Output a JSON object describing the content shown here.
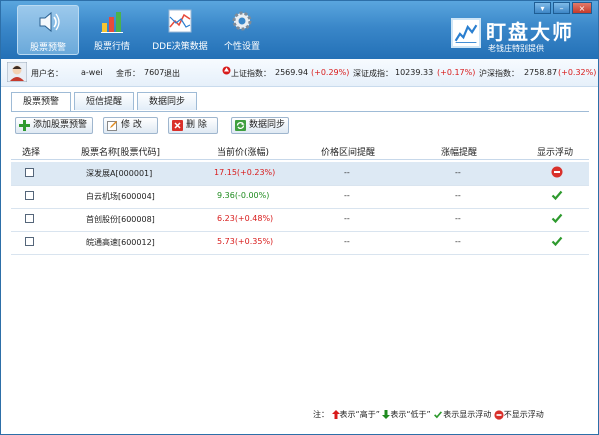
{
  "nav": {
    "items": [
      {
        "label": "股票预警",
        "active": true,
        "icon": "speaker-icon"
      },
      {
        "label": "股票行情",
        "active": false,
        "icon": "bar-chart-icon"
      },
      {
        "label": "DDE决策数据",
        "active": false,
        "icon": "line-chart-icon"
      },
      {
        "label": "个性设置",
        "active": false,
        "icon": "gear-icon"
      }
    ]
  },
  "window_controls": {
    "menu": "▾",
    "minimize": "–",
    "close": "×"
  },
  "brand": {
    "title": "盯盘大师",
    "subtitle": "老钱庄特别提供"
  },
  "user": {
    "username_label": "用户名：",
    "username": "a-wei",
    "coins_label": "金币：",
    "coins": "7607",
    "logout": "退出"
  },
  "indices": [
    {
      "label": "上证指数：",
      "value": "2569.94",
      "change": "(+0.29%)"
    },
    {
      "label": "深证成指：",
      "value": "10239.33",
      "change": "(+0.17%)"
    },
    {
      "label": "沪深指数：",
      "value": "2758.87",
      "change": "(+0.32%)"
    }
  ],
  "tabs": [
    {
      "label": "股票预警",
      "active": true
    },
    {
      "label": "短信提醒",
      "active": false
    },
    {
      "label": "数据同步",
      "active": false
    }
  ],
  "toolbar": {
    "add_label": "添加股票预警",
    "edit_label": "修 改",
    "delete_label": "删 除",
    "sync_label": "数据同步"
  },
  "table": {
    "headers": [
      "选择",
      "股票名称[股票代码]",
      "当前价(涨幅)",
      "价格区间提醒",
      "涨幅提醒",
      "显示浮动"
    ],
    "rows": [
      {
        "name": "深发展A[000001]",
        "price": "17.15(+0.23%)",
        "trend": "up",
        "range": "--",
        "change_alert": "--",
        "display": "off"
      },
      {
        "name": "白云机场[600004]",
        "price": "9.36(-0.00%)",
        "trend": "down",
        "range": "--",
        "change_alert": "--",
        "display": "on"
      },
      {
        "name": "首创股份[600008]",
        "price": "6.23(+0.48%)",
        "trend": "up",
        "range": "--",
        "change_alert": "--",
        "display": "on"
      },
      {
        "name": "皖通高速[600012]",
        "price": "5.73(+0.35%)",
        "trend": "up",
        "range": "--",
        "change_alert": "--",
        "display": "on"
      }
    ]
  },
  "legend": {
    "note": "注：",
    "up_text": "表示“高于”",
    "down_text": "表示“低于”",
    "show_text": "表示显示浮动",
    "hide_text": "不显示浮动"
  },
  "colors": {
    "up": "#d81b1b",
    "down": "#1f8b1f",
    "header": "#3a87c9"
  }
}
